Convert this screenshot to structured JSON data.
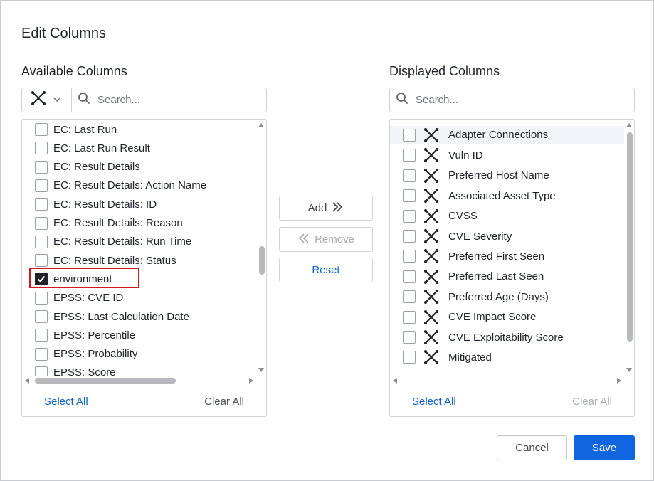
{
  "dialog": {
    "title": "Edit Columns"
  },
  "available": {
    "title": "Available Columns",
    "type_filter_icon": "adapter-cross-icon",
    "search_placeholder": "Search...",
    "items": [
      {
        "label": "EC: Last Run",
        "checked": false
      },
      {
        "label": "EC: Last Run Result",
        "checked": false
      },
      {
        "label": "EC: Result Details",
        "checked": false
      },
      {
        "label": "EC: Result Details: Action Name",
        "checked": false
      },
      {
        "label": "EC: Result Details: ID",
        "checked": false
      },
      {
        "label": "EC: Result Details: Reason",
        "checked": false
      },
      {
        "label": "EC: Result Details: Run Time",
        "checked": false
      },
      {
        "label": "EC: Result Details: Status",
        "checked": false
      },
      {
        "label": "environment",
        "checked": true
      },
      {
        "label": "EPSS: CVE ID",
        "checked": false
      },
      {
        "label": "EPSS: Last Calculation Date",
        "checked": false
      },
      {
        "label": "EPSS: Percentile",
        "checked": false
      },
      {
        "label": "EPSS: Probability",
        "checked": false
      },
      {
        "label": "EPSS: Score",
        "checked": false
      }
    ],
    "select_all": "Select All",
    "clear_all": "Clear All"
  },
  "actions": {
    "add": "Add",
    "remove": "Remove",
    "reset": "Reset"
  },
  "displayed": {
    "title": "Displayed Columns",
    "search_placeholder": "Search...",
    "items": [
      {
        "label": "Adapter Connections",
        "checked": false
      },
      {
        "label": "Vuln ID",
        "checked": false
      },
      {
        "label": "Preferred Host Name",
        "checked": false
      },
      {
        "label": "Associated Asset Type",
        "checked": false
      },
      {
        "label": "CVSS",
        "checked": false
      },
      {
        "label": "CVE Severity",
        "checked": false
      },
      {
        "label": "Preferred First Seen",
        "checked": false
      },
      {
        "label": "Preferred Last Seen",
        "checked": false
      },
      {
        "label": "Preferred Age (Days)",
        "checked": false
      },
      {
        "label": "CVE Impact Score",
        "checked": false
      },
      {
        "label": "CVE Exploitability Score",
        "checked": false
      },
      {
        "label": "Mitigated",
        "checked": false
      }
    ],
    "row_icon": "adapter-cross-icon",
    "select_all": "Select All",
    "clear_all": "Clear All"
  },
  "footer": {
    "cancel": "Cancel",
    "save": "Save"
  },
  "colors": {
    "accent": "#1065e0",
    "link": "#1060c8",
    "highlight": "#d0191c"
  }
}
